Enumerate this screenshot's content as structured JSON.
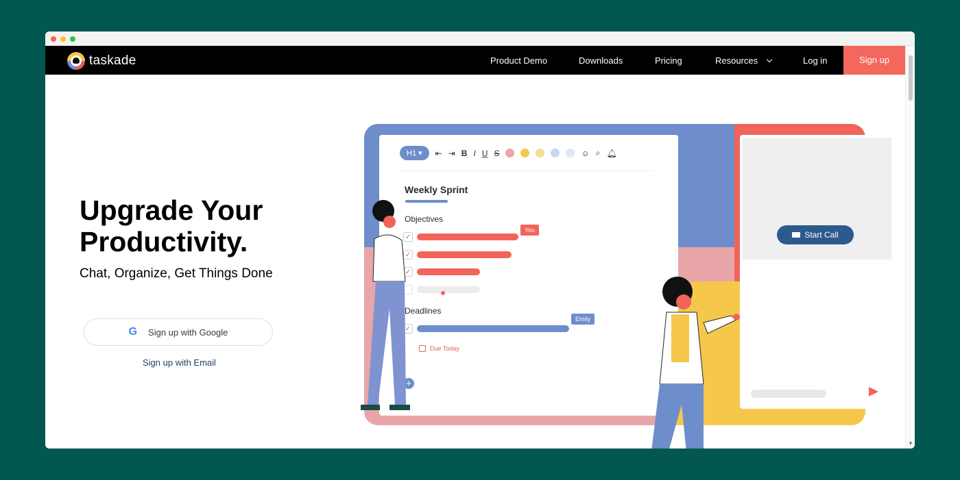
{
  "nav": {
    "brand": "taskade",
    "items": [
      "Product Demo",
      "Downloads",
      "Pricing",
      "Resources",
      "Log in"
    ],
    "signup": "Sign up"
  },
  "hero": {
    "headline": "Upgrade Your Productivity.",
    "subhead": "Chat, Organize, Get Things Done",
    "google_button": "Sign up with Google",
    "email_link": "Sign up with Email"
  },
  "editor": {
    "heading_button": "H1",
    "format_buttons": [
      "B",
      "I",
      "U",
      "S"
    ],
    "title": "Weekly Sprint",
    "sections": {
      "objectives": "Objectives",
      "deadlines": "Deadlines"
    },
    "cursor_you": "You",
    "cursor_emily": "Emily",
    "due_label": "Due Today",
    "add_button": "+"
  },
  "call": {
    "start_call": "Start Call"
  },
  "colors": {
    "accent_red": "#f4675d",
    "blue": "#6d8ecb",
    "yellow": "#f5c84c",
    "pink": "#e8a6a8",
    "background": "#035751"
  }
}
